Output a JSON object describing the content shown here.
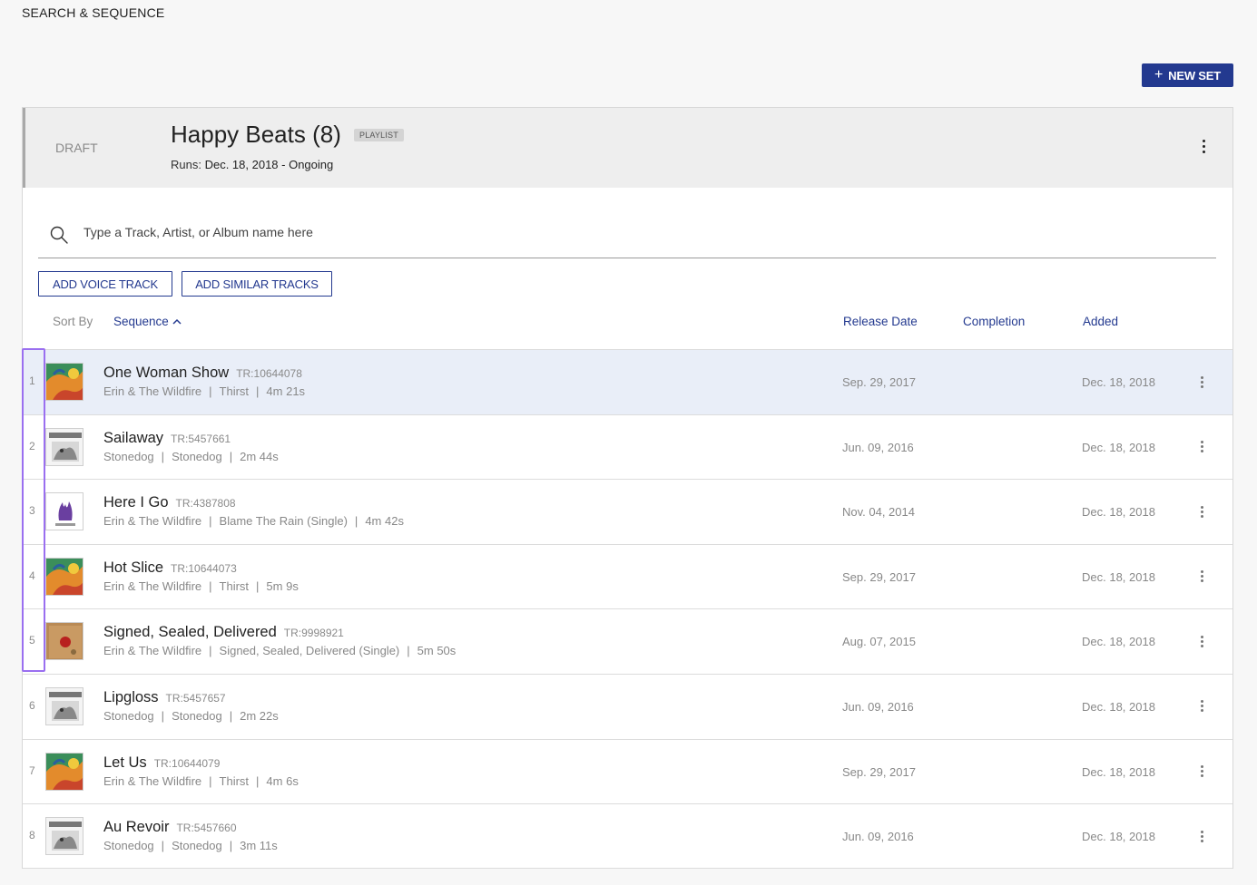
{
  "app": {
    "title": "SEARCH & SEQUENCE"
  },
  "toolbar": {
    "new_set_label": "NEW SET",
    "new_set_icon": "plus-icon"
  },
  "set": {
    "status": "DRAFT",
    "title": "Happy Beats (8)",
    "badge": "PLAYLIST",
    "runs_label": "Runs:",
    "runs_value": "Dec. 18, 2018 - Ongoing"
  },
  "search": {
    "placeholder": "Type a Track, Artist, or Album name here",
    "value": ""
  },
  "actions": {
    "add_voice": "ADD VOICE TRACK",
    "add_similar": "ADD SIMILAR TRACKS"
  },
  "sort": {
    "label": "Sort By",
    "value": "Sequence",
    "direction_icon": "chevron-up-icon",
    "columns": {
      "release": "Release Date",
      "completion": "Completion",
      "added": "Added"
    }
  },
  "colors": {
    "accent": "#23398f",
    "selected_row": "#e9eef8",
    "highlight": "#9a6ff0"
  },
  "tracks": [
    {
      "num": "1",
      "title": "One Woman Show",
      "id": "TR:10644078",
      "artist": "Erin & The Wildfire",
      "album": "Thirst",
      "duration": "4m 21s",
      "release": "Sep. 29, 2017",
      "added": "Dec. 18, 2018",
      "art": "thirst"
    },
    {
      "num": "2",
      "title": "Sailaway",
      "id": "TR:5457661",
      "artist": "Stonedog",
      "album": "Stonedog",
      "duration": "2m 44s",
      "release": "Jun. 09, 2016",
      "added": "Dec. 18, 2018",
      "art": "stonedog"
    },
    {
      "num": "3",
      "title": "Here I Go",
      "id": "TR:4387808",
      "artist": "Erin & The Wildfire",
      "album": "Blame The Rain (Single)",
      "duration": "4m 42s",
      "release": "Nov. 04, 2014",
      "added": "Dec. 18, 2018",
      "art": "blame"
    },
    {
      "num": "4",
      "title": "Hot Slice",
      "id": "TR:10644073",
      "artist": "Erin & The Wildfire",
      "album": "Thirst",
      "duration": "5m 9s",
      "release": "Sep. 29, 2017",
      "added": "Dec. 18, 2018",
      "art": "thirst"
    },
    {
      "num": "5",
      "title": "Signed, Sealed, Delivered",
      "id": "TR:9998921",
      "artist": "Erin & The Wildfire",
      "album": "Signed, Sealed, Delivered (Single)",
      "duration": "5m 50s",
      "release": "Aug. 07, 2015",
      "added": "Dec. 18, 2018",
      "art": "sealed"
    },
    {
      "num": "6",
      "title": "Lipgloss",
      "id": "TR:5457657",
      "artist": "Stonedog",
      "album": "Stonedog",
      "duration": "2m 22s",
      "release": "Jun. 09, 2016",
      "added": "Dec. 18, 2018",
      "art": "stonedog"
    },
    {
      "num": "7",
      "title": "Let Us",
      "id": "TR:10644079",
      "artist": "Erin & The Wildfire",
      "album": "Thirst",
      "duration": "4m 6s",
      "release": "Sep. 29, 2017",
      "added": "Dec. 18, 2018",
      "art": "thirst"
    },
    {
      "num": "8",
      "title": "Au Revoir",
      "id": "TR:5457660",
      "artist": "Stonedog",
      "album": "Stonedog",
      "duration": "3m 11s",
      "release": "Jun. 09, 2016",
      "added": "Dec. 18, 2018",
      "art": "stonedog"
    }
  ]
}
